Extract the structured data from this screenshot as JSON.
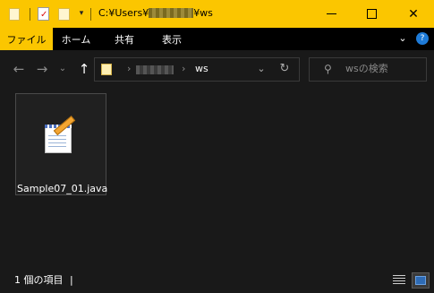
{
  "window": {
    "path_prefix": "C:¥Users¥",
    "path_suffix": "¥ws",
    "minimize": "—",
    "maximize": "☐",
    "close": "✕"
  },
  "ribbon": {
    "tabs": [
      {
        "label": "ファイル"
      },
      {
        "label": "ホーム"
      },
      {
        "label": "共有"
      },
      {
        "label": "表示"
      }
    ]
  },
  "address": {
    "current_folder": "ws",
    "sep": "›"
  },
  "search": {
    "placeholder": "wsの検索"
  },
  "files": [
    {
      "name": "Sample07_01.java",
      "icon": "notepad-icon"
    }
  ],
  "status": {
    "item_count": "1 個の項目",
    "divider": "|"
  }
}
